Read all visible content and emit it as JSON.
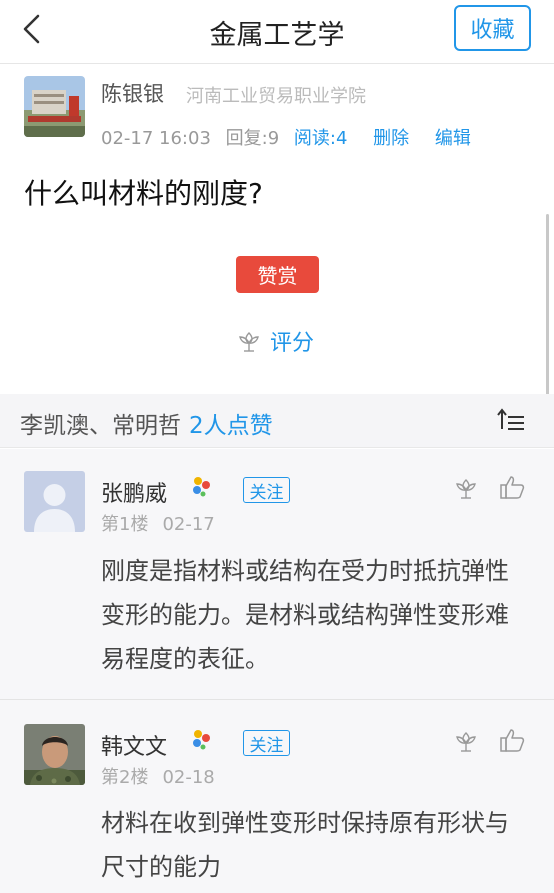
{
  "header": {
    "title": "金属工艺学",
    "favorite_label": "收藏"
  },
  "post": {
    "author": "陈银银",
    "school": "河南工业贸易职业学院",
    "datetime": "02-17 16:03",
    "replies": "回复:9",
    "reads": "阅读:4",
    "delete_label": "删除",
    "edit_label": "编辑",
    "question": "什么叫材料的刚度?",
    "reward_label": "赞赏",
    "rate_label": "评分"
  },
  "likes": {
    "names": "李凯澳、常明哲",
    "count": "2人点赞"
  },
  "comments": [
    {
      "name": "张鹏威",
      "follow_label": "关注",
      "floor": "第1楼",
      "date": "02-17",
      "text": "刚度是指材料或结构在受力时抵抗弹性变形的能力。是材料或结构弹性变形难易程度的表征。"
    },
    {
      "name": "韩文文",
      "follow_label": "关注",
      "floor": "第2楼",
      "date": "02-18",
      "text": "材料在收到弹性变形时保持原有形状与尺寸的能力"
    }
  ],
  "colors": {
    "accent": "#2196e8",
    "reward": "#e84a3c"
  }
}
